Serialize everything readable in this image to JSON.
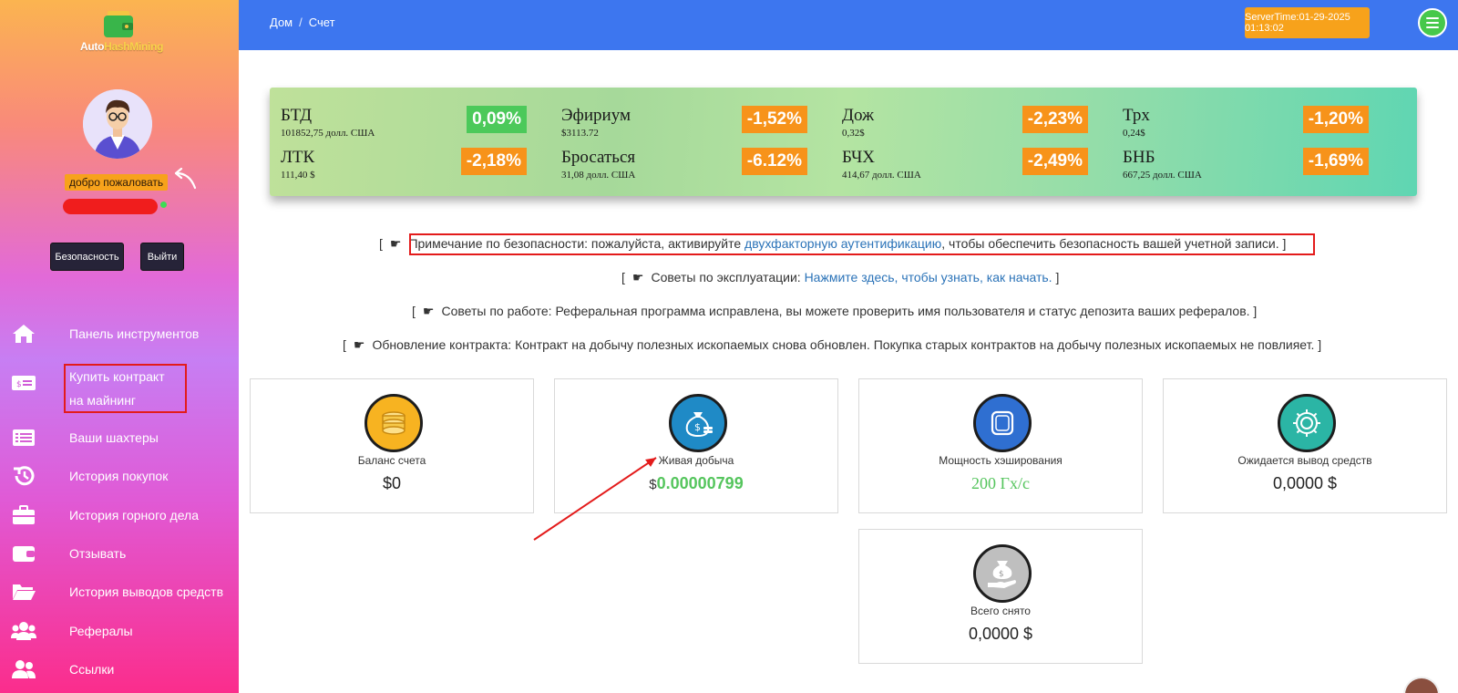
{
  "brand": {
    "name_part1": "Auto",
    "name_part2": "HashMining"
  },
  "user": {
    "welcome": "добро пожаловать"
  },
  "sidebar_buttons": {
    "security": "Безопасность",
    "logout": "Выйти"
  },
  "nav": [
    {
      "label": "Панель инструментов",
      "icon": "home-icon"
    },
    {
      "label": "Купить контракт на майнинг",
      "icon": "money-bill-icon"
    },
    {
      "label": "Ваши шахтеры",
      "icon": "list-icon"
    },
    {
      "label": "История покупок",
      "icon": "history-icon"
    },
    {
      "label": "История горного дела",
      "icon": "briefcase-icon"
    },
    {
      "label": "Отзывать",
      "icon": "wallet-icon"
    },
    {
      "label": "История выводов средств",
      "icon": "folder-open-icon"
    },
    {
      "label": "Рефералы",
      "icon": "users-icon"
    },
    {
      "label": "Ссылки",
      "icon": "user-friends-icon"
    }
  ],
  "breadcrumb": {
    "home": "Дом",
    "separator": "/",
    "current": "Счет"
  },
  "server_time": "ServerTime:01-29-2025 01:13:02",
  "ticker": [
    {
      "name": "БТД",
      "price": "101852,75 долл. США",
      "change": "0,09%",
      "color": "#4cc95a"
    },
    {
      "name": "Эфириум",
      "price": "$3113.72",
      "change": "-1,52%",
      "color": "#f7931a"
    },
    {
      "name": "Дож",
      "price": "0,32$",
      "change": "-2,23%",
      "color": "#f7931a"
    },
    {
      "name": "Трх",
      "price": "0,24$",
      "change": "-1,20%",
      "color": "#f7931a"
    },
    {
      "name": "ЛТК",
      "price": "111,40 $",
      "change": "-2,18%",
      "color": "#f7931a"
    },
    {
      "name": "Бросаться",
      "price": "31,08 долл. США",
      "change": "-6.12%",
      "color": "#f7931a"
    },
    {
      "name": "БЧХ",
      "price": "414,67 долл. США",
      "change": "-2,49%",
      "color": "#f7931a"
    },
    {
      "name": "БНБ",
      "price": "667,25 долл. США",
      "change": "-1,69%",
      "color": "#f7931a"
    }
  ],
  "notes": {
    "open": "[",
    "close": "]",
    "hand": "☛",
    "security": {
      "text_before": "Примечание по безопасности: пожалуйста, активируйте ",
      "link": "двухфакторную аутентификацию",
      "text_after": ", чтобы обеспечить безопасность вашей учетной записи."
    },
    "tips": {
      "text_before": "Советы по эксплуатации: ",
      "link": "Нажмите здесь, чтобы узнать, как начать."
    },
    "work": {
      "text": "Советы по работе: Реферальная программа исправлена, вы можете проверить имя пользователя и статус депозита ваших рефералов."
    },
    "contract": {
      "text": "Обновление контракта: Контракт на добычу полезных ископаемых снова обновлен. Покупка старых контрактов на добычу полезных ископаемых не повлияет."
    }
  },
  "cards": {
    "balance": {
      "label": "Баланс счета",
      "value": "$0",
      "icon": "coins-icon",
      "color": "#f7b321"
    },
    "live": {
      "label": "Живая добыча",
      "currency": "$",
      "value": "0.00000799",
      "icon": "money-bag-icon",
      "color": "#1f8ac6"
    },
    "hashrate": {
      "label": "Мощность хэширования",
      "value": "200 Гх/с",
      "icon": "chip-icon",
      "color": "#2f6fd1"
    },
    "pending": {
      "label": "Ожидается вывод средств",
      "value": "0,0000 $",
      "icon": "gear-icon",
      "color": "#2bb5a5"
    },
    "withdrawn": {
      "label": "Всего снято",
      "value": "0,0000 $",
      "icon": "hand-money-icon",
      "color": "#bfbfbf"
    }
  }
}
